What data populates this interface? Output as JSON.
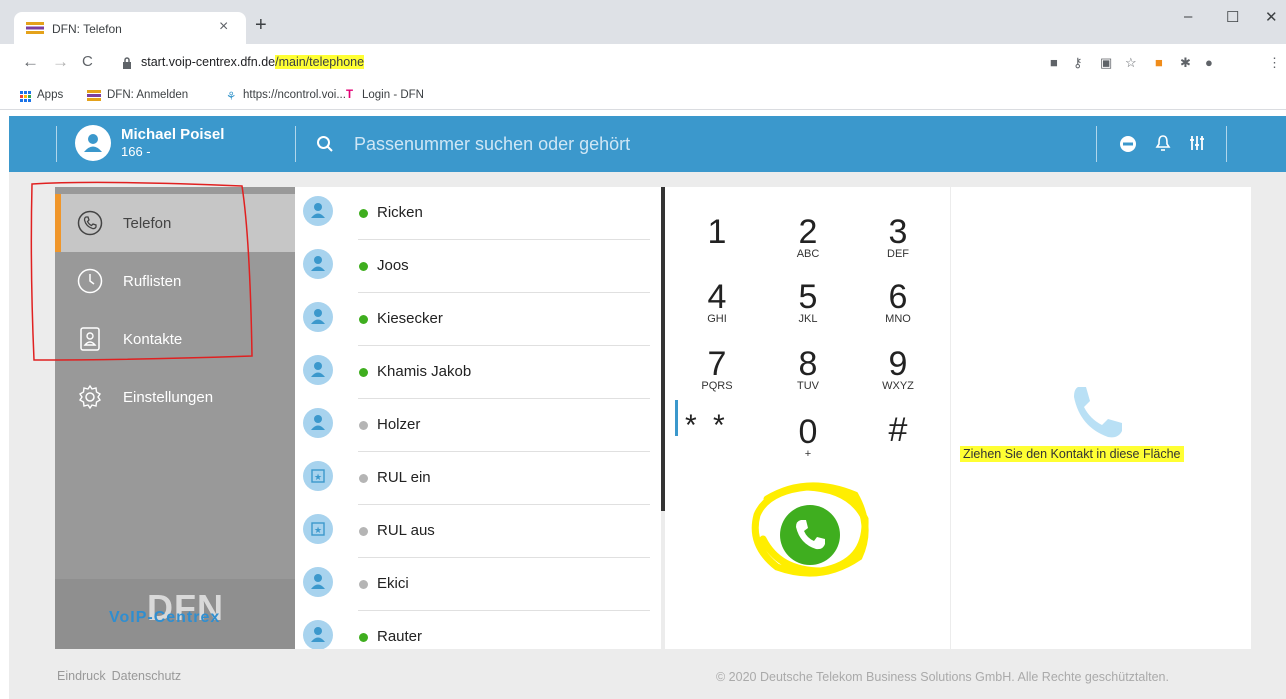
{
  "browser": {
    "tab_title": "DFN: Telefon",
    "url_host": "start.voip-centrex.dfn.de",
    "url_path": "/main/telephone",
    "bookmarks": [
      "Apps",
      "DFN: Anmelden",
      "https://ncontrol.voi...",
      "Login - DFN"
    ]
  },
  "header": {
    "user_name": "Michael Poisel",
    "user_ext": "166 -",
    "search_placeholder": "Passenummer suchen oder gehört"
  },
  "sidebar": {
    "items": [
      {
        "label": "Telefon",
        "icon": "phone-icon"
      },
      {
        "label": "Ruflisten",
        "icon": "clock-icon"
      },
      {
        "label": "Kontakte",
        "icon": "contact-card-icon"
      },
      {
        "label": "Einstellungen",
        "icon": "gear-icon"
      }
    ],
    "logo_main": "DFN",
    "logo_sub": "VoIP-Centrex"
  },
  "contacts": [
    {
      "name": "Ricken",
      "status": "online",
      "type": "person"
    },
    {
      "name": "Joos",
      "status": "online",
      "type": "person"
    },
    {
      "name": "Kiesecker",
      "status": "online",
      "type": "person"
    },
    {
      "name": "Khamis Jakob",
      "status": "online",
      "type": "person"
    },
    {
      "name": "Holzer",
      "status": "offline",
      "type": "person"
    },
    {
      "name": "RUL ein",
      "status": "offline",
      "type": "feature"
    },
    {
      "name": "RUL aus",
      "status": "offline",
      "type": "feature"
    },
    {
      "name": "Ekici",
      "status": "offline",
      "type": "person"
    },
    {
      "name": "Rauter",
      "status": "online",
      "type": "person"
    }
  ],
  "dialpad": {
    "keys": [
      {
        "num": "1",
        "sub": ""
      },
      {
        "num": "2",
        "sub": "ABC"
      },
      {
        "num": "3",
        "sub": "DEF"
      },
      {
        "num": "4",
        "sub": "GHI"
      },
      {
        "num": "5",
        "sub": "JKL"
      },
      {
        "num": "6",
        "sub": "MNO"
      },
      {
        "num": "7",
        "sub": "PQRS"
      },
      {
        "num": "8",
        "sub": "TUV"
      },
      {
        "num": "9",
        "sub": "WXYZ"
      },
      {
        "num": "* *",
        "sub": ""
      },
      {
        "num": "0",
        "sub": "+"
      },
      {
        "num": "#",
        "sub": ""
      }
    ]
  },
  "dropzone": {
    "text": "Ziehen Sie den Kontakt in diese Fläche"
  },
  "footer": {
    "links": [
      "Eindruck",
      "Datenschutz"
    ],
    "copyright": "© 2020 Deutsche Telekom Business Solutions GmbH. Alle Rechte geschütztalten."
  },
  "colors": {
    "brand_blue": "#3b98cc",
    "online_green": "#3fae1f",
    "offline_gray": "#b5b5b5",
    "active_accent": "#f0962a",
    "highlight_yellow": "#ffff33"
  }
}
